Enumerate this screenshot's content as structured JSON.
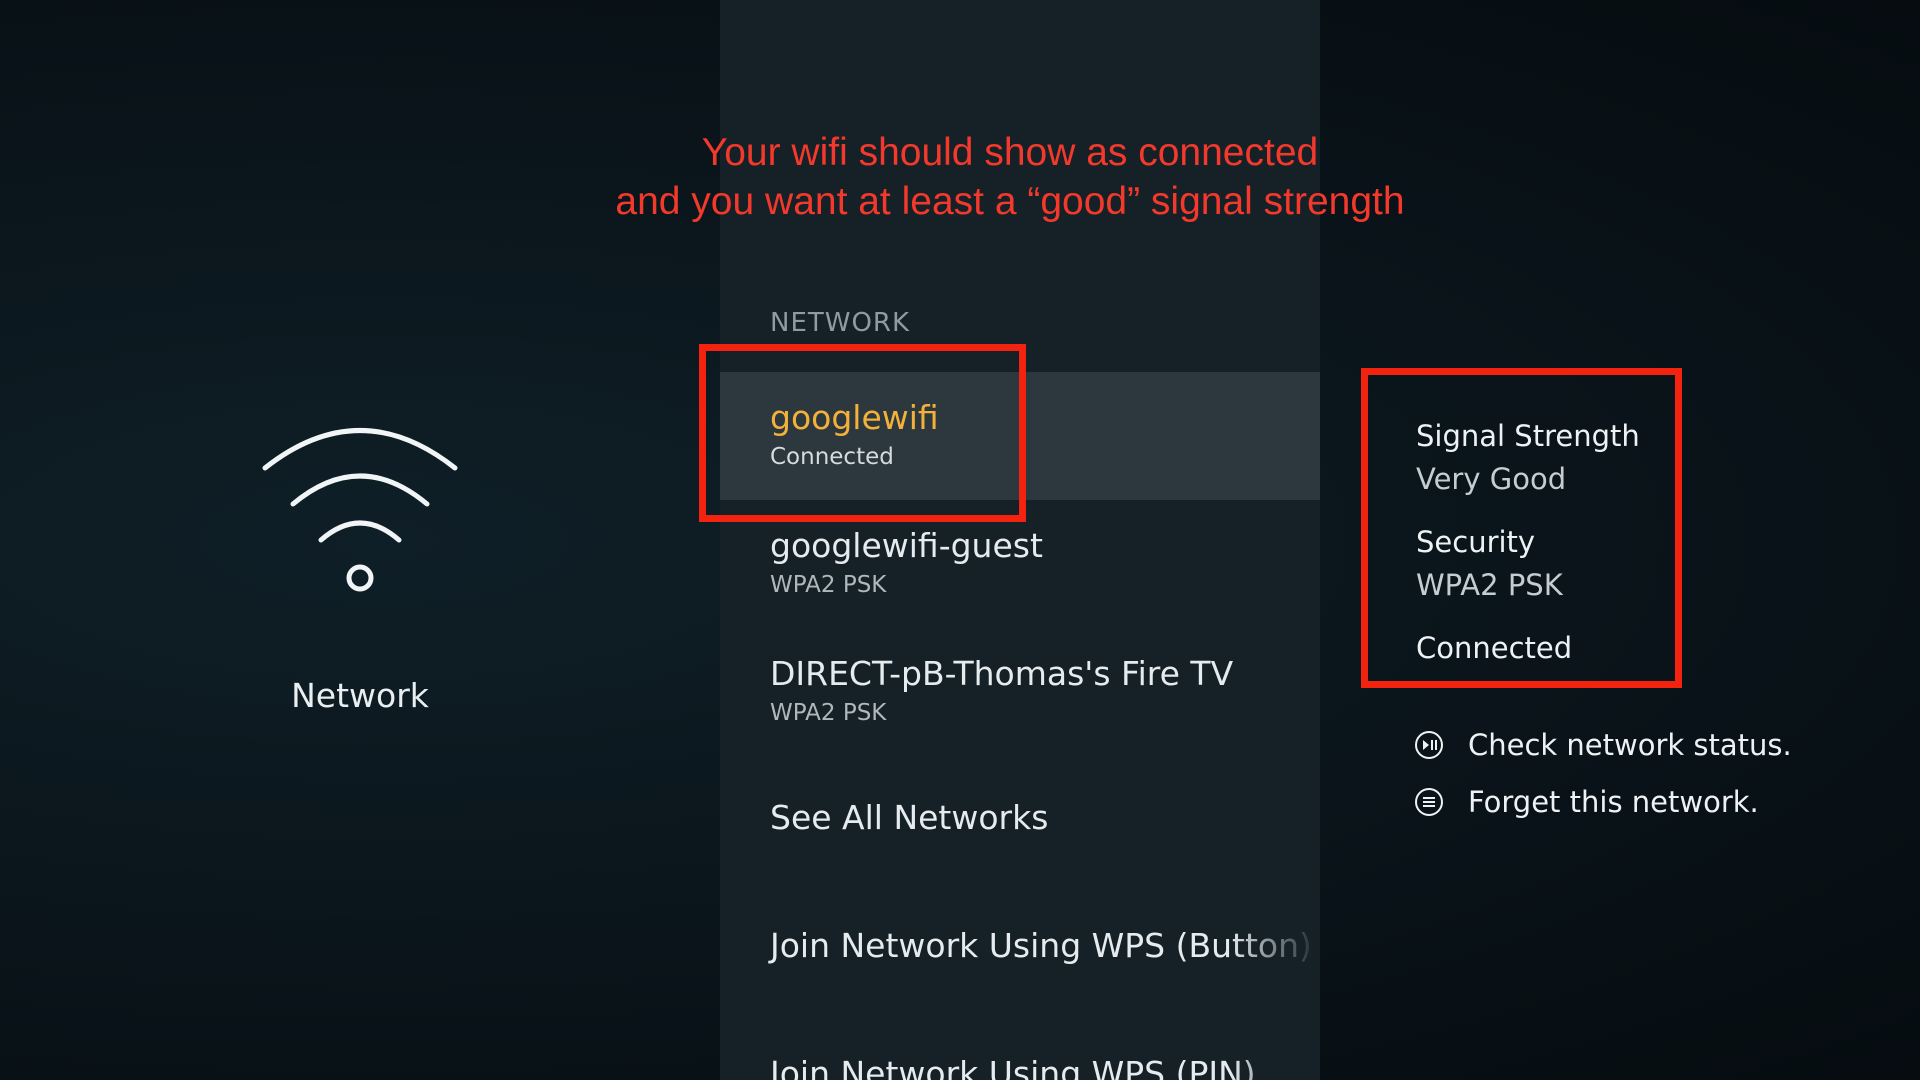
{
  "annotation": {
    "line1": "Your wifi should show as connected",
    "line2": "and you want at least a “good” signal strength"
  },
  "left_panel": {
    "icon": "wifi-icon",
    "title": "Network"
  },
  "network_list": {
    "section_label": "NETWORK",
    "items": [
      {
        "name": "googlewifi",
        "status": "Connected",
        "selected": true
      },
      {
        "name": "googlewifi-guest",
        "status": "WPA2 PSK"
      },
      {
        "name": "DIRECT-pB-Thomas's Fire TV",
        "status": "WPA2 PSK"
      },
      {
        "name": "See All Networks"
      },
      {
        "name": "Join Network Using WPS (Button)"
      },
      {
        "name": "Join Network Using WPS (PIN)"
      }
    ]
  },
  "details": {
    "signal_label": "Signal Strength",
    "signal_value": "Very Good",
    "security_label": "Security",
    "security_value": "WPA2 PSK",
    "connection_status": "Connected"
  },
  "actions": [
    {
      "icon": "play-pause-icon",
      "label": "Check network status."
    },
    {
      "icon": "menu-icon",
      "label": "Forget this network."
    }
  ],
  "colors": {
    "highlight": "#f3b13a",
    "annotation": "#f2392b",
    "annotation_box": "#f4230f"
  }
}
